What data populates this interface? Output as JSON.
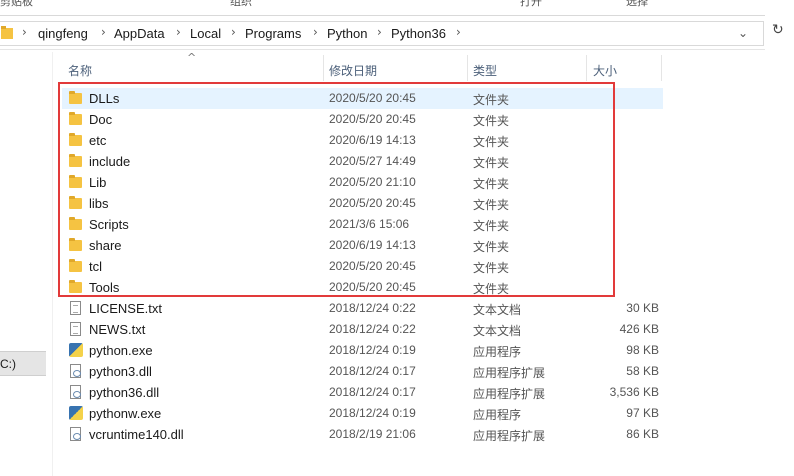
{
  "ribbon": {
    "left_text": "剪贴板",
    "mid_text": "组织",
    "right1_text": "打开",
    "right2_text": "选择"
  },
  "address": {
    "crumbs": [
      "qingfeng",
      "AppData",
      "Local",
      "Programs",
      "Python",
      "Python36"
    ],
    "separator": "›",
    "dropdown_glyph": "⌄",
    "refresh_glyph": "↻"
  },
  "nav": {
    "selected_label": "C:)"
  },
  "columns": {
    "name": "名称",
    "modified": "修改日期",
    "type": "类型",
    "size": "大小",
    "sort_glyph": "^"
  },
  "files": [
    {
      "name": "DLLs",
      "modified": "2020/5/20 20:45",
      "type": "文件夹",
      "size": "",
      "icon": "folder-icon",
      "selected": true
    },
    {
      "name": "Doc",
      "modified": "2020/5/20 20:45",
      "type": "文件夹",
      "size": "",
      "icon": "folder-icon"
    },
    {
      "name": "etc",
      "modified": "2020/6/19 14:13",
      "type": "文件夹",
      "size": "",
      "icon": "folder-icon"
    },
    {
      "name": "include",
      "modified": "2020/5/27 14:49",
      "type": "文件夹",
      "size": "",
      "icon": "folder-icon"
    },
    {
      "name": "Lib",
      "modified": "2020/5/20 21:10",
      "type": "文件夹",
      "size": "",
      "icon": "folder-icon"
    },
    {
      "name": "libs",
      "modified": "2020/5/20 20:45",
      "type": "文件夹",
      "size": "",
      "icon": "folder-icon"
    },
    {
      "name": "Scripts",
      "modified": "2021/3/6 15:06",
      "type": "文件夹",
      "size": "",
      "icon": "folder-icon"
    },
    {
      "name": "share",
      "modified": "2020/6/19 14:13",
      "type": "文件夹",
      "size": "",
      "icon": "folder-icon"
    },
    {
      "name": "tcl",
      "modified": "2020/5/20 20:45",
      "type": "文件夹",
      "size": "",
      "icon": "folder-icon"
    },
    {
      "name": "Tools",
      "modified": "2020/5/20 20:45",
      "type": "文件夹",
      "size": "",
      "icon": "folder-icon"
    },
    {
      "name": "LICENSE.txt",
      "modified": "2018/12/24 0:22",
      "type": "文本文档",
      "size": "30 KB",
      "icon": "text-file-icon"
    },
    {
      "name": "NEWS.txt",
      "modified": "2018/12/24 0:22",
      "type": "文本文档",
      "size": "426 KB",
      "icon": "text-file-icon"
    },
    {
      "name": "python.exe",
      "modified": "2018/12/24 0:19",
      "type": "应用程序",
      "size": "98 KB",
      "icon": "python-exe-icon"
    },
    {
      "name": "python3.dll",
      "modified": "2018/12/24 0:17",
      "type": "应用程序扩展",
      "size": "58 KB",
      "icon": "dll-file-icon"
    },
    {
      "name": "python36.dll",
      "modified": "2018/12/24 0:17",
      "type": "应用程序扩展",
      "size": "3,536 KB",
      "icon": "dll-file-icon"
    },
    {
      "name": "pythonw.exe",
      "modified": "2018/12/24 0:19",
      "type": "应用程序",
      "size": "97 KB",
      "icon": "pythonw-exe-icon"
    },
    {
      "name": "vcruntime140.dll",
      "modified": "2018/2/19 21:06",
      "type": "应用程序扩展",
      "size": "86 KB",
      "icon": "dll-file-icon"
    }
  ],
  "colors": {
    "annotation_border": "#e23a3a",
    "selection": "#e5f3ff",
    "folder": "#f5c342"
  }
}
